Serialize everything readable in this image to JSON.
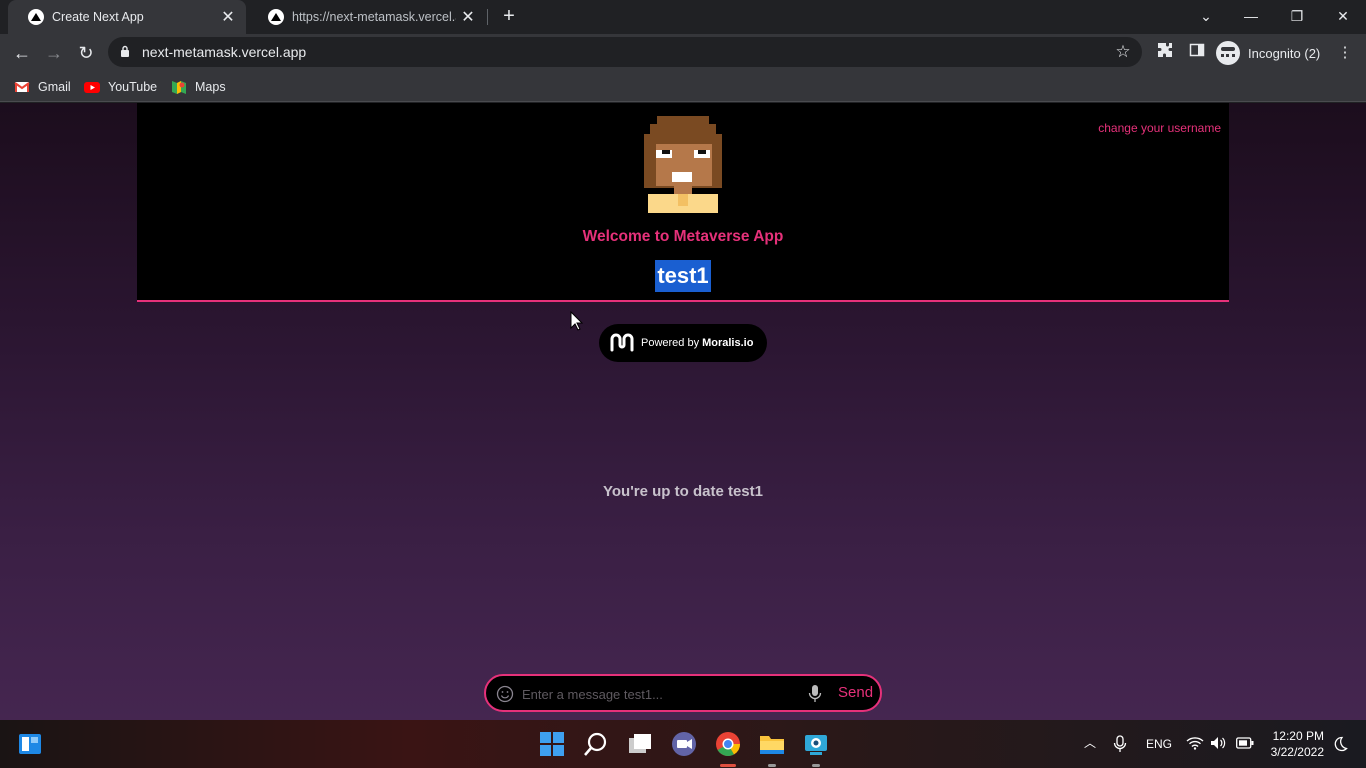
{
  "browser": {
    "tabs": [
      {
        "title": "Create Next App",
        "active": true
      },
      {
        "title": "https://next-metamask.vercel.app",
        "active": false
      }
    ],
    "url": "next-metamask.vercel.app",
    "incognito_label": "Incognito (2)",
    "bookmarks": [
      {
        "label": "Gmail",
        "icon": "gmail-icon"
      },
      {
        "label": "YouTube",
        "icon": "youtube-icon"
      },
      {
        "label": "Maps",
        "icon": "maps-icon"
      }
    ]
  },
  "app": {
    "change_username": "change your username",
    "welcome": "Welcome to Metaverse App",
    "username": "test1",
    "powered_prefix": "Powered by",
    "powered_brand": "Moralis.io",
    "status": "You're up to date test1",
    "message_placeholder": "Enter a message test1...",
    "send_label": "Send"
  },
  "taskbar": {
    "language": "ENG",
    "time": "12:20 PM",
    "date": "3/22/2022"
  },
  "colors": {
    "accent": "#e6317a",
    "selection": "#1a5fd1"
  }
}
